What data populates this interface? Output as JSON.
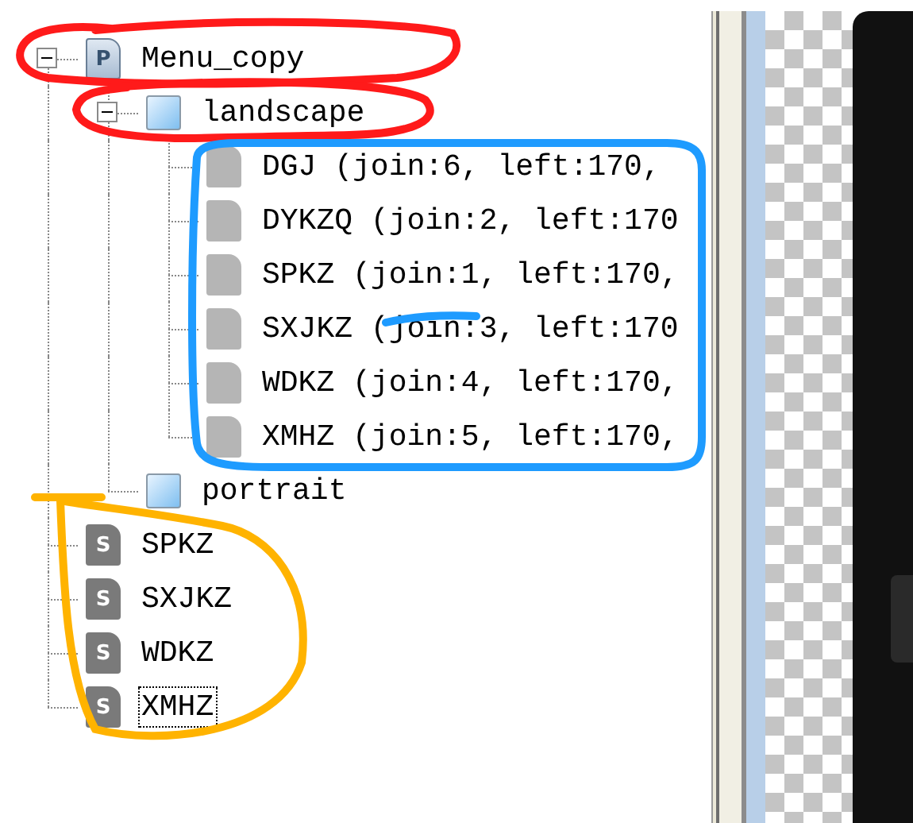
{
  "tree": [
    {
      "label": "Menu_copy",
      "kind": "page",
      "icon_letter": "P",
      "expanded": true,
      "selected": false,
      "children": [
        {
          "label": "landscape",
          "kind": "folder",
          "expanded": true,
          "selected": false,
          "children": [
            {
              "label": "DGJ (join:6, left:170,",
              "kind": "document",
              "selected": false
            },
            {
              "label": "DYKZQ (join:2, left:170",
              "kind": "document",
              "selected": false
            },
            {
              "label": "SPKZ (join:1, left:170,",
              "kind": "document",
              "selected": false
            },
            {
              "label": "SXJKZ (join:3, left:170",
              "kind": "document",
              "selected": false
            },
            {
              "label": "WDKZ (join:4, left:170,",
              "kind": "document",
              "selected": false
            },
            {
              "label": "XMHZ (join:5, left:170,",
              "kind": "document",
              "selected": false
            }
          ]
        },
        {
          "label": "portrait",
          "kind": "folder",
          "selected": false
        }
      ]
    },
    {
      "label": "SPKZ",
      "kind": "script",
      "icon_letter": "S",
      "selected": false
    },
    {
      "label": "SXJKZ",
      "kind": "script",
      "icon_letter": "S",
      "selected": false
    },
    {
      "label": "WDKZ",
      "kind": "script",
      "icon_letter": "S",
      "selected": false
    },
    {
      "label": "XMHZ",
      "kind": "script",
      "icon_letter": "S",
      "selected": true
    }
  ]
}
